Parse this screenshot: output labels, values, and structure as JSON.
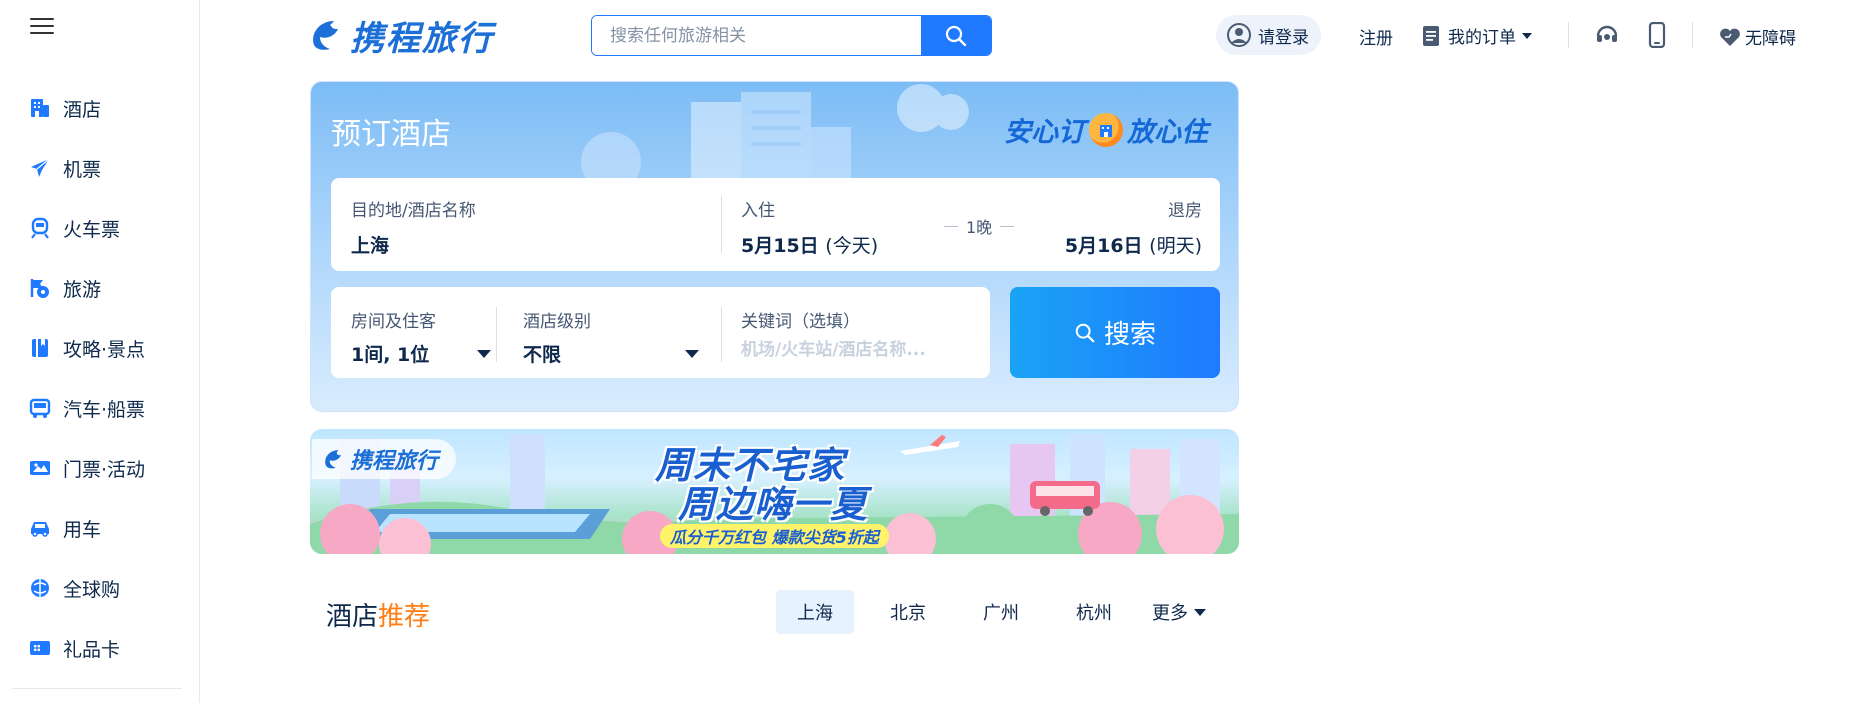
{
  "sidebar": {
    "menu_icon": "hamburger-icon",
    "items": [
      {
        "label": "酒店",
        "icon": "hotel-icon"
      },
      {
        "label": "机票",
        "icon": "airplane-icon"
      },
      {
        "label": "火车票",
        "icon": "train-icon"
      },
      {
        "label": "旅游",
        "icon": "travel-icon"
      },
      {
        "label": "攻略·景点",
        "icon": "guidebook-icon"
      },
      {
        "label": "汽车·船票",
        "icon": "bus-icon"
      },
      {
        "label": "门票·活动",
        "icon": "ticket-icon"
      },
      {
        "label": "用车",
        "icon": "car-icon"
      },
      {
        "label": "全球购",
        "icon": "global-shopping-icon"
      },
      {
        "label": "礼品卡",
        "icon": "gift-card-icon"
      }
    ]
  },
  "header": {
    "logo_text": "携程旅行",
    "search_placeholder": "搜索任何旅游相关",
    "login_label": "请登录",
    "register_label": "注册",
    "orders_label": "我的订单",
    "accessibility_label": "无障碍"
  },
  "booking": {
    "title": "预订酒店",
    "slogan_left": "安心订",
    "slogan_right": "放心住",
    "destination_label": "目的地/酒店名称",
    "destination_value": "上海",
    "checkin_label": "入住",
    "checkin_date": "5月15日",
    "checkin_day": "(今天)",
    "nights": "1晚",
    "checkout_label": "退房",
    "checkout_date": "5月16日",
    "checkout_day": "(明天)",
    "rooms_label": "房间及住客",
    "rooms_value": "1间, 1位",
    "level_label": "酒店级别",
    "level_value": "不限",
    "keyword_label": "关键词（选填）",
    "keyword_placeholder": "机场/火车站/酒店名称...",
    "search_label": "搜索"
  },
  "banner": {
    "logo_text": "携程旅行",
    "headline_1": "周末不宅家",
    "headline_2": "周边嗨一夏",
    "subline": "瓜分千万红包  爆款尖货5折起"
  },
  "recommend": {
    "title_a": "酒店",
    "title_b": "推荐",
    "cities": [
      "上海",
      "北京",
      "广州",
      "杭州"
    ],
    "active_city_index": 0,
    "more_label": "更多"
  },
  "colors": {
    "brand_blue": "#1f7aff",
    "accent_orange": "#ff7d13",
    "text_dark": "#0f294d"
  }
}
